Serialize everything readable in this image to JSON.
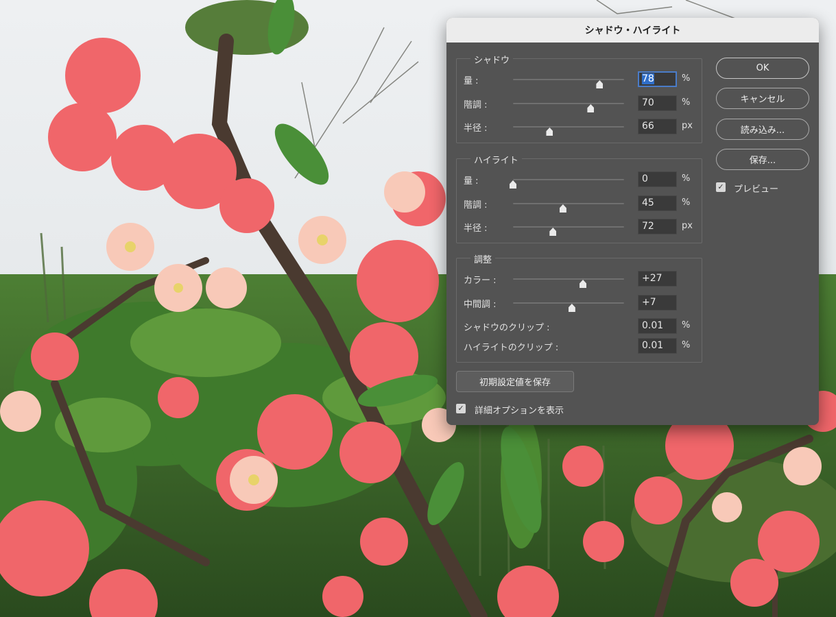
{
  "dialog": {
    "title": "シャドウ・ハイライト",
    "shadow": {
      "title": "シャドウ",
      "rows": [
        {
          "label": "量 :",
          "value": "78",
          "unit": "%",
          "slider": 0.78
        },
        {
          "label": "階調 :",
          "value": "70",
          "unit": "%",
          "slider": 0.7
        },
        {
          "label": "半径 :",
          "value": "66",
          "unit": "px",
          "slider": 0.33
        }
      ]
    },
    "highlight": {
      "title": "ハイライト",
      "rows": [
        {
          "label": "量 :",
          "value": "0",
          "unit": "%",
          "slider": 0.0
        },
        {
          "label": "階調 :",
          "value": "45",
          "unit": "%",
          "slider": 0.45
        },
        {
          "label": "半径 :",
          "value": "72",
          "unit": "px",
          "slider": 0.36
        }
      ]
    },
    "adjust": {
      "title": "調整",
      "rows": [
        {
          "label": "カラー :",
          "value": "+27",
          "unit": "",
          "slider": 0.63
        },
        {
          "label": "中間調 :",
          "value": "+7",
          "unit": "",
          "slider": 0.53
        }
      ],
      "clips": [
        {
          "label": "シャドウのクリップ :",
          "value": "0.01",
          "unit": "%"
        },
        {
          "label": "ハイライトのクリップ :",
          "value": "0.01",
          "unit": "%"
        }
      ]
    },
    "buttons": {
      "ok": "OK",
      "cancel": "キャンセル",
      "load": "読み込み...",
      "save": "保存..."
    },
    "preview_label": "プレビュー",
    "preview_checked": true,
    "save_defaults": "初期設定値を保存",
    "show_more_options": "詳細オプションを表示",
    "show_more_checked": true
  },
  "icons": {
    "checkbox": "checkmark-icon",
    "slider_thumb": "slider-thumb-icon"
  }
}
